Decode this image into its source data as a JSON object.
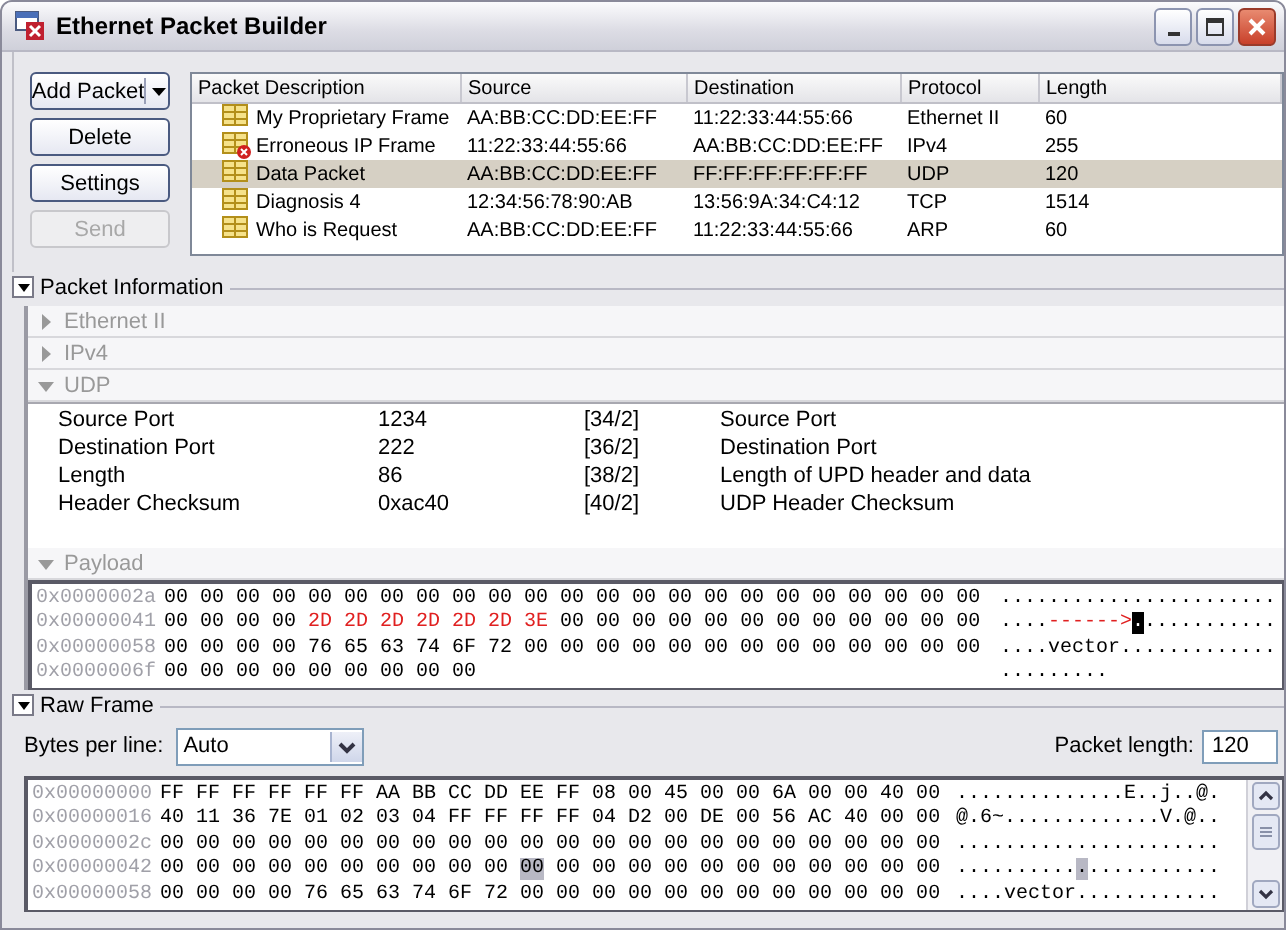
{
  "window": {
    "title": "Ethernet Packet Builder"
  },
  "actions": [
    {
      "label": "Add Packet",
      "kind": "dropdown",
      "disabled": false
    },
    {
      "label": "Delete",
      "kind": "button",
      "disabled": false
    },
    {
      "label": "Settings",
      "kind": "button",
      "disabled": false
    },
    {
      "label": "Send",
      "kind": "button",
      "disabled": true
    }
  ],
  "packets": {
    "columns": [
      "Packet Description",
      "Source",
      "Destination",
      "Protocol",
      "Length"
    ],
    "rows": [
      {
        "kind": "frame",
        "selected": false,
        "cells": [
          "My Proprietary Frame",
          "AA:BB:CC:DD:EE:FF",
          "11:22:33:44:55:66",
          "Ethernet II",
          "60"
        ]
      },
      {
        "kind": "error",
        "selected": false,
        "cells": [
          "Erroneous IP Frame",
          "11:22:33:44:55:66",
          "AA:BB:CC:DD:EE:FF",
          "IPv4",
          "255"
        ]
      },
      {
        "kind": "frame",
        "selected": true,
        "cells": [
          "Data Packet",
          "AA:BB:CC:DD:EE:FF",
          "FF:FF:FF:FF:FF:FF",
          "UDP",
          "120"
        ]
      },
      {
        "kind": "frame",
        "selected": false,
        "cells": [
          "Diagnosis 4",
          "12:34:56:78:90:AB",
          "13:56:9A:34:C4:12",
          "TCP",
          "1514"
        ]
      },
      {
        "kind": "frame",
        "selected": false,
        "cells": [
          "Who is Request",
          "AA:BB:CC:DD:EE:FF",
          "11:22:33:44:55:66",
          "ARP",
          "60"
        ]
      }
    ]
  },
  "packet_information": {
    "title": "Packet Information",
    "expanded": true,
    "sections": [
      {
        "title": "Ethernet II",
        "expanded": false
      },
      {
        "title": "IPv4",
        "expanded": false
      },
      {
        "title": "UDP",
        "expanded": true,
        "fields": [
          {
            "name": "Source Port",
            "value": "1234",
            "offset": "[34/2]",
            "description": "Source Port"
          },
          {
            "name": "Destination Port",
            "value": "222",
            "offset": "[36/2]",
            "description": "Destination Port"
          },
          {
            "name": "Length",
            "value": "86",
            "offset": "[38/2]",
            "description": "Length of UPD header and data"
          },
          {
            "name": "Header Checksum",
            "value": "0xac40",
            "offset": "[40/2]",
            "description": "UDP Header Checksum"
          }
        ]
      },
      {
        "title": "Payload",
        "expanded": true,
        "hex_rows": [
          {
            "address": "0x0000002a",
            "hex": [
              {
                "kind": "plain",
                "text": "00 00 00 00 00 00 00 00 00 00 00 00 00 00 00 00 00 00 00 00 00 00 00"
              }
            ],
            "ascii": [
              {
                "kind": "plain",
                "text": "......................."
              }
            ]
          },
          {
            "address": "0x00000041",
            "hex": [
              {
                "kind": "plain",
                "text": "00 00 00 00 "
              },
              {
                "kind": "changed",
                "text": "2D 2D 2D 2D 2D 2D 3E"
              },
              {
                "kind": "plain",
                "text": " 00 00 00 00 00 00 00 00 00 00 00 00"
              }
            ],
            "ascii": [
              {
                "kind": "plain",
                "text": "...."
              },
              {
                "kind": "changed",
                "text": "------>"
              },
              {
                "kind": "cursor",
                "text": "."
              },
              {
                "kind": "plain",
                "text": "..........."
              }
            ]
          },
          {
            "address": "0x00000058",
            "hex": [
              {
                "kind": "plain",
                "text": "00 00 00 00 76 65 63 74 6F 72 00 00 00 00 00 00 00 00 00 00 00 00 00"
              }
            ],
            "ascii": [
              {
                "kind": "plain",
                "text": "....vector............."
              }
            ]
          },
          {
            "address": "0x0000006f",
            "hex": [
              {
                "kind": "plain",
                "text": "00 00 00 00 00 00 00 00 00"
              }
            ],
            "ascii": [
              {
                "kind": "plain",
                "text": "........."
              }
            ]
          }
        ]
      }
    ]
  },
  "raw_frame": {
    "title": "Raw Frame",
    "expanded": true,
    "bytes_per_line_label": "Bytes per line:",
    "bytes_per_line": "Auto",
    "packet_length_label": "Packet length:",
    "packet_length": "120",
    "hex_rows": [
      {
        "address": "0x00000000",
        "hex": [
          {
            "kind": "plain",
            "text": "FF FF FF FF FF FF AA BB CC DD EE FF 08 00 45 00 00 6A 00 00 40 00"
          }
        ],
        "ascii": [
          {
            "kind": "plain",
            "text": "..............E..j..@."
          }
        ]
      },
      {
        "address": "0x00000016",
        "hex": [
          {
            "kind": "plain",
            "text": "40 11 36 7E 01 02 03 04 FF FF FF FF 04 D2 00 DE 00 56 AC 40 00 00"
          }
        ],
        "ascii": [
          {
            "kind": "plain",
            "text": "@.6~.............V.@.."
          }
        ]
      },
      {
        "address": "0x0000002c",
        "hex": [
          {
            "kind": "plain",
            "text": "00 00 00 00 00 00 00 00 00 00 00 00 00 00 00 00 00 00 00 00 00 00"
          }
        ],
        "ascii": [
          {
            "kind": "plain",
            "text": "......................"
          }
        ]
      },
      {
        "address": "0x00000042",
        "hex": [
          {
            "kind": "plain",
            "text": "00 00 00 00 00 00 00 00 00 00 "
          },
          {
            "kind": "selected",
            "text": "00"
          },
          {
            "kind": "plain",
            "text": " 00 00 00 00 00 00 00 00 00 00 00"
          }
        ],
        "ascii": [
          {
            "kind": "plain",
            "text": ".........."
          },
          {
            "kind": "selected",
            "text": "."
          },
          {
            "kind": "plain",
            "text": "..........."
          }
        ]
      },
      {
        "address": "0x00000058",
        "hex": [
          {
            "kind": "plain",
            "text": "00 00 00 00 76 65 63 74 6F 72 00 00 00 00 00 00 00 00 00 00 00 00"
          }
        ],
        "ascii": [
          {
            "kind": "plain",
            "text": "....vector............"
          }
        ]
      }
    ]
  }
}
